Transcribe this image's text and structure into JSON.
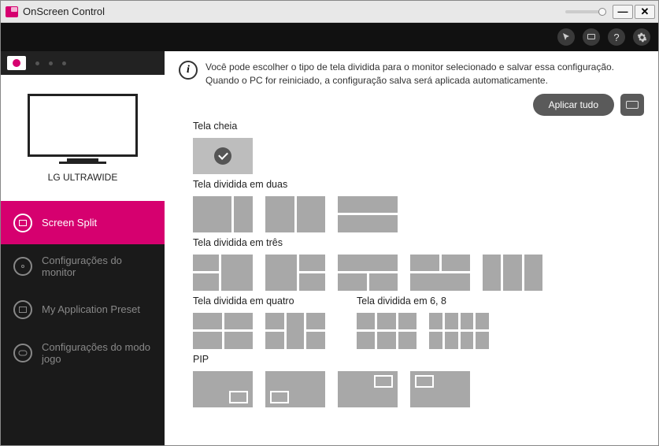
{
  "window": {
    "title": "OnScreen Control"
  },
  "toolbar": {
    "help": "?"
  },
  "sidebar": {
    "monitor_name": "LG ULTRAWIDE",
    "nav": [
      {
        "label": "Screen Split",
        "active": true
      },
      {
        "label": "Configurações do monitor",
        "active": false
      },
      {
        "label": "My Application Preset",
        "active": false
      },
      {
        "label": "Configurações do modo jogo",
        "active": false
      }
    ]
  },
  "main": {
    "description": "Você pode escolher o tipo de tela dividida para o monitor selecionado e salvar essa configuração. Quando o PC for reiniciado, a configuração salva será aplicada automaticamente.",
    "apply_label": "Aplicar tudo",
    "sections": {
      "full": "Tela cheia",
      "two": "Tela dividida em duas",
      "three": "Tela dividida em três",
      "four": "Tela dividida em quatro",
      "six_eight": "Tela dividida em 6, 8",
      "pip": "PIP"
    }
  }
}
